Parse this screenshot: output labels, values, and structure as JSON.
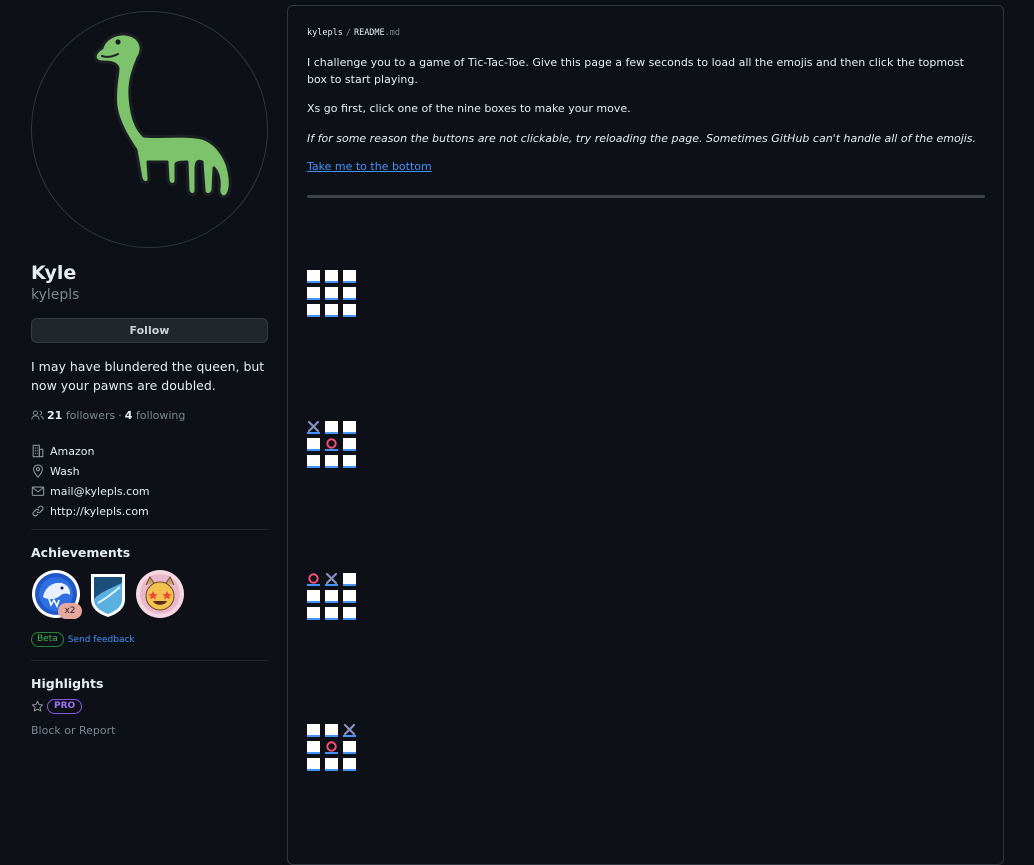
{
  "profile": {
    "display_name": "Kyle",
    "username": "kylepls",
    "follow_label": "Follow",
    "bio": "I may have blundered the queen, but now your pawns are doubled.",
    "followers_count": "21",
    "followers_label": "followers",
    "separator": "·",
    "following_count": "4",
    "following_label": "following",
    "details": {
      "company": "Amazon",
      "location": "Wash",
      "email": "mail@kylepls.com",
      "website": "http://kylepls.com"
    }
  },
  "achievements": {
    "title": "Achievements",
    "badges": [
      {
        "name": "shark-badge",
        "count": "x2"
      },
      {
        "name": "pull-shark-badge"
      },
      {
        "name": "starstruck-cat-badge"
      }
    ],
    "beta_label": "Beta",
    "feedback_label": "Send feedback"
  },
  "highlights": {
    "title": "Highlights",
    "pro_label": "PRO",
    "block_label": "Block or Report"
  },
  "readme": {
    "owner": "kylepls",
    "sep": "/",
    "file_name": "README",
    "file_ext": ".md",
    "intro": "I challenge you to a game of Tic-Tac-Toe. Give this page a few seconds to load all the emojis and then click the topmost box to start playing.",
    "rules": "Xs go first, click one of the nine boxes to make your move.",
    "note": "If for some reason the buttons are not clickable, try reloading the page. Sometimes GitHub can't handle all of the emojis.",
    "bottom_link": "Take me to the bottom"
  },
  "boards": [
    [
      "empty",
      "empty",
      "empty",
      "empty",
      "empty",
      "empty",
      "empty",
      "empty",
      "empty"
    ],
    [
      "x",
      "empty",
      "empty",
      "empty",
      "o",
      "empty",
      "empty",
      "empty",
      "empty"
    ],
    [
      "o",
      "x",
      "empty",
      "empty",
      "empty",
      "empty",
      "empty",
      "empty",
      "empty"
    ],
    [
      "empty",
      "empty",
      "x",
      "empty",
      "o",
      "empty",
      "empty",
      "empty",
      "empty"
    ]
  ],
  "colors": {
    "background": "#0d1117",
    "link": "#4493f8",
    "x_mark": "#8b8fc0",
    "o_mark": "#f04e77",
    "dino": "#7cc36b"
  }
}
